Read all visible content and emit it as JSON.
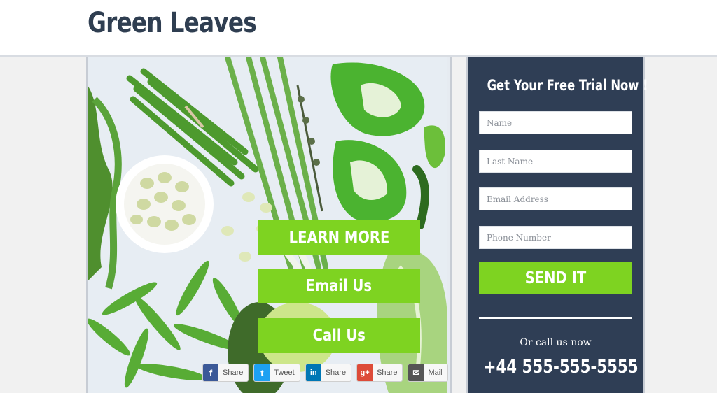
{
  "header": {
    "brand": "Green Leaves"
  },
  "hero": {
    "buttons": {
      "learn_more": "LEARN MORE",
      "email_us": "Email Us",
      "call_us": "Call Us"
    },
    "share": [
      {
        "icon": "facebook-icon",
        "label": "Share",
        "color": "#3b5998",
        "glyph": "f"
      },
      {
        "icon": "twitter-icon",
        "label": "Tweet",
        "color": "#1da1f2",
        "glyph": "t"
      },
      {
        "icon": "linkedin-icon",
        "label": "Share",
        "color": "#0077b5",
        "glyph": "in"
      },
      {
        "icon": "google-plus-icon",
        "label": "Share",
        "color": "#dd4b39",
        "glyph": "g+"
      },
      {
        "icon": "mail-icon",
        "label": "Mail",
        "color": "#555555",
        "glyph": "✉"
      }
    ]
  },
  "form": {
    "title": "Get Your Free Trial Now !",
    "name_placeholder": "Name",
    "last_name_placeholder": "Last Name",
    "email_placeholder": "Email Address",
    "phone_placeholder": "Phone Number",
    "submit_label": "SEND IT",
    "call_text": "Or call us now",
    "phone": "+44 555-555-5555"
  },
  "colors": {
    "accent": "#7ed321",
    "panel": "#2f3e55",
    "brand": "#2f3e51"
  }
}
